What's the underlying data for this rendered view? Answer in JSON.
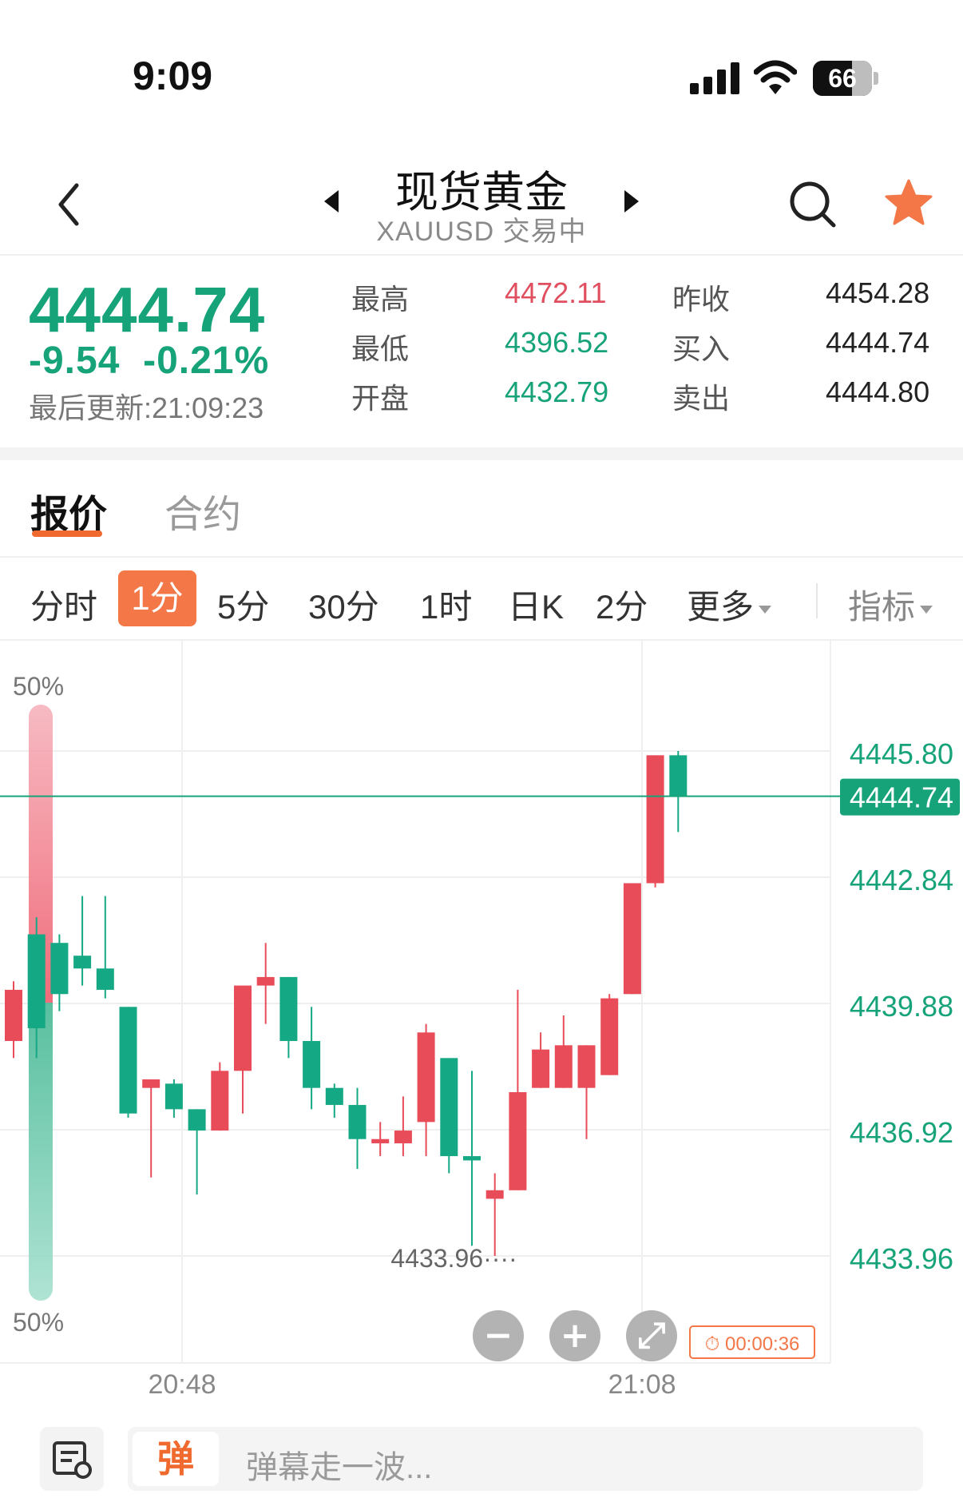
{
  "status": {
    "time": "9:09",
    "battery": "66"
  },
  "header": {
    "title": "现货黄金",
    "subtitle": "XAUUSD 交易中"
  },
  "quote": {
    "price": "4444.74",
    "change": "-9.54",
    "change_pct": "-0.21%",
    "update_label": "最后更新:21:09:23",
    "stats": [
      {
        "label": "最高",
        "value": "4472.11",
        "color": "#e04f5f"
      },
      {
        "label": "最低",
        "value": "4396.52",
        "color": "#17a37a"
      },
      {
        "label": "开盘",
        "value": "4432.79",
        "color": "#17a37a"
      },
      {
        "label": "昨收",
        "value": "4454.28",
        "color": "#222222"
      },
      {
        "label": "买入",
        "value": "4444.74",
        "color": "#222222"
      },
      {
        "label": "卖出",
        "value": "4444.80",
        "color": "#222222"
      }
    ]
  },
  "tabs": [
    "报价",
    "合约"
  ],
  "timeframes": {
    "items": [
      "分时",
      "1分",
      "5分",
      "30分",
      "1时",
      "日K",
      "2分"
    ],
    "more": "更多",
    "indicator": "指标",
    "selected": "1分"
  },
  "colors": {
    "up": "#e84c59",
    "down": "#15a884",
    "accent": "#f06a30"
  },
  "chart_data": {
    "type": "candlestick",
    "price_ticks": [
      "4445.80",
      "4442.84",
      "4439.88",
      "4436.92",
      "4433.96"
    ],
    "x_ticks": [
      "20:48",
      "21:08"
    ],
    "last_price_label": "4444.74",
    "min_marker": "4433.96",
    "depth_top": "50%",
    "depth_bottom": "50%",
    "timer": "00:00:36",
    "candles": [
      {
        "o": 4439.0,
        "h": 4440.4,
        "l": 4438.6,
        "c": 4440.2
      },
      {
        "o": 4441.5,
        "h": 4441.9,
        "l": 4438.6,
        "c": 4439.3
      },
      {
        "o": 4441.3,
        "h": 4441.5,
        "l": 4439.7,
        "c": 4440.1
      },
      {
        "o": 4441.0,
        "h": 4442.4,
        "l": 4440.3,
        "c": 4440.7
      },
      {
        "o": 4440.7,
        "h": 4442.4,
        "l": 4440.0,
        "c": 4440.2
      },
      {
        "o": 4439.8,
        "h": 4439.8,
        "l": 4437.2,
        "c": 4437.3
      },
      {
        "o": 4437.9,
        "h": 4438.1,
        "l": 4435.8,
        "c": 4438.1
      },
      {
        "o": 4438.0,
        "h": 4438.1,
        "l": 4437.2,
        "c": 4437.4
      },
      {
        "o": 4437.4,
        "h": 4437.4,
        "l": 4435.4,
        "c": 4436.9
      },
      {
        "o": 4436.9,
        "h": 4438.5,
        "l": 4436.9,
        "c": 4438.3
      },
      {
        "o": 4438.3,
        "h": 4440.3,
        "l": 4437.3,
        "c": 4440.3
      },
      {
        "o": 4440.3,
        "h": 4441.3,
        "l": 4439.4,
        "c": 4440.5
      },
      {
        "o": 4440.5,
        "h": 4440.5,
        "l": 4438.6,
        "c": 4439.0
      },
      {
        "o": 4439.0,
        "h": 4439.8,
        "l": 4437.4,
        "c": 4437.9
      },
      {
        "o": 4437.9,
        "h": 4438.0,
        "l": 4437.2,
        "c": 4437.5
      },
      {
        "o": 4437.5,
        "h": 4437.9,
        "l": 4436.0,
        "c": 4436.7
      },
      {
        "o": 4436.6,
        "h": 4437.1,
        "l": 4436.3,
        "c": 4436.7
      },
      {
        "o": 4436.6,
        "h": 4437.7,
        "l": 4436.3,
        "c": 4436.9
      },
      {
        "o": 4437.1,
        "h": 4439.4,
        "l": 4436.3,
        "c": 4439.2
      },
      {
        "o": 4438.6,
        "h": 4438.6,
        "l": 4435.9,
        "c": 4436.3
      },
      {
        "o": 4436.3,
        "h": 4438.3,
        "l": 4434.2,
        "c": 4436.2
      },
      {
        "o": 4435.3,
        "h": 4435.9,
        "l": 4433.96,
        "c": 4435.5
      },
      {
        "o": 4435.5,
        "h": 4440.2,
        "l": 4435.5,
        "c": 4437.8
      },
      {
        "o": 4437.9,
        "h": 4439.2,
        "l": 4437.9,
        "c": 4438.8
      },
      {
        "o": 4437.9,
        "h": 4439.6,
        "l": 4437.9,
        "c": 4438.9
      },
      {
        "o": 4437.9,
        "h": 4438.9,
        "l": 4436.7,
        "c": 4438.9
      },
      {
        "o": 4438.2,
        "h": 4440.1,
        "l": 4438.2,
        "c": 4440.0
      },
      {
        "o": 4440.1,
        "h": 4442.6,
        "l": 4440.1,
        "c": 4442.7
      },
      {
        "o": 4442.7,
        "h": 4444.0,
        "l": 4442.6,
        "c": 4445.7
      },
      {
        "o": 4445.7,
        "h": 4445.8,
        "l": 4443.9,
        "c": 4444.74
      }
    ]
  },
  "danmaku": {
    "tag": "弹",
    "placeholder": "弹幕走一波..."
  }
}
